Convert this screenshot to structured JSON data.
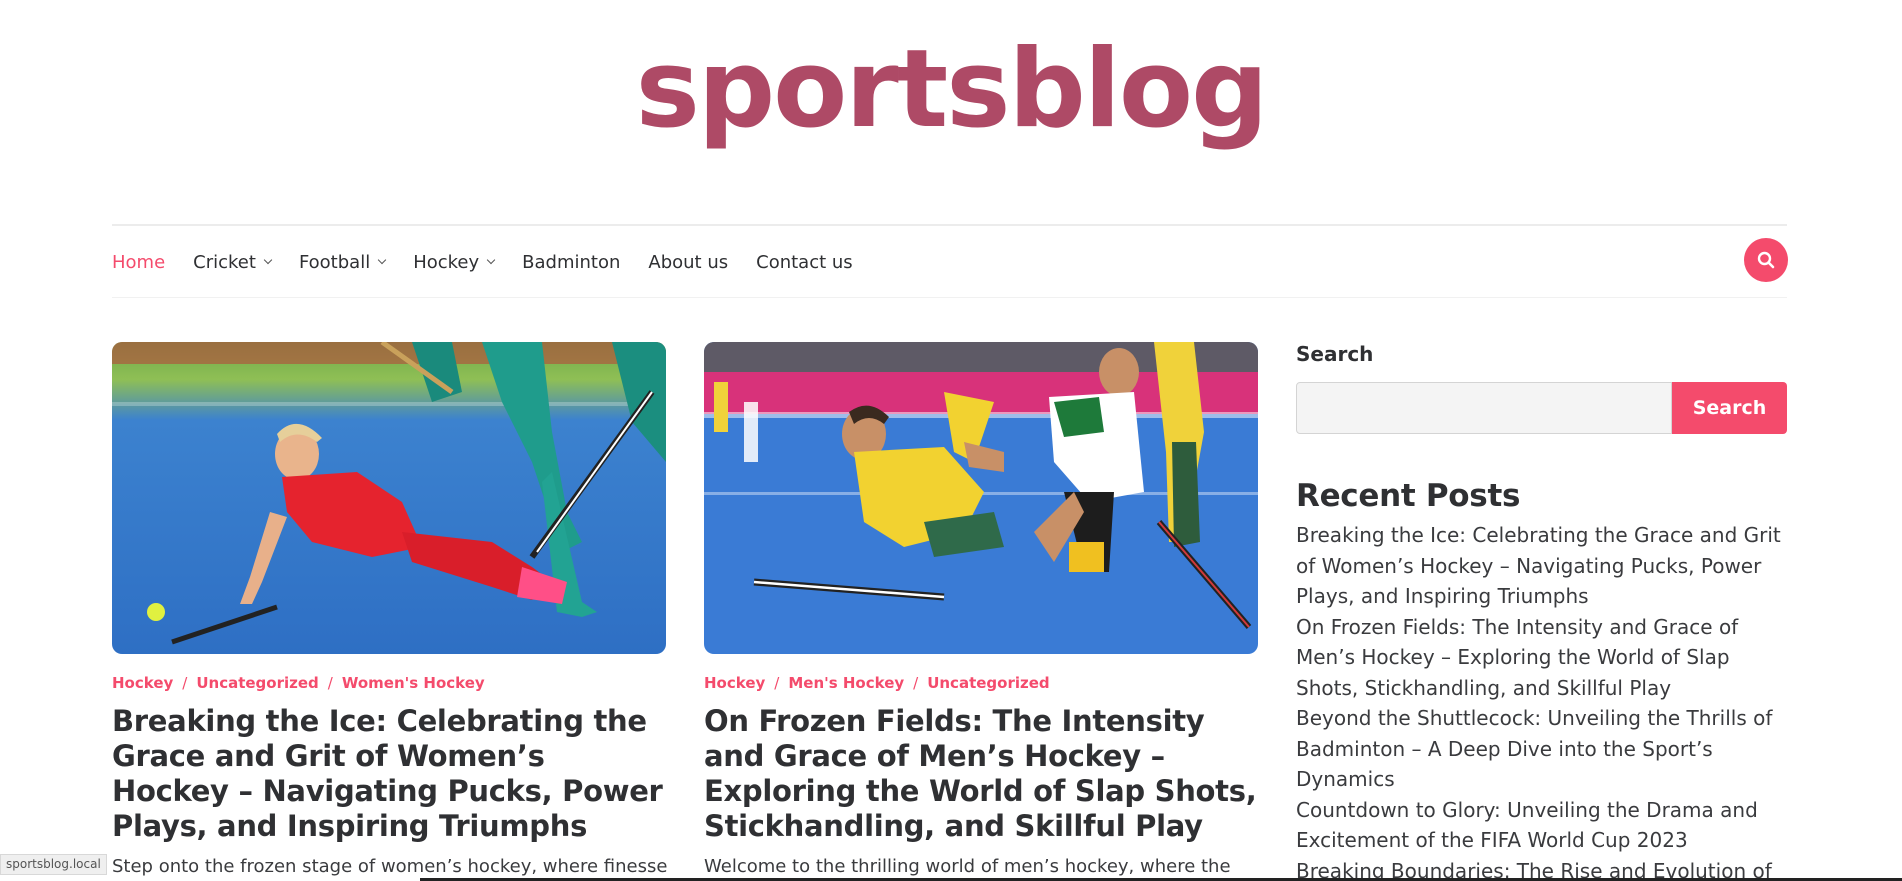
{
  "site": {
    "title": "sportsblog"
  },
  "nav": {
    "items": [
      {
        "label": "Home",
        "active": true,
        "has_submenu": false
      },
      {
        "label": "Cricket",
        "active": false,
        "has_submenu": true
      },
      {
        "label": "Football",
        "active": false,
        "has_submenu": true
      },
      {
        "label": "Hockey",
        "active": false,
        "has_submenu": true
      },
      {
        "label": "Badminton",
        "active": false,
        "has_submenu": false
      },
      {
        "label": "About us",
        "active": false,
        "has_submenu": false
      },
      {
        "label": "Contact us",
        "active": false,
        "has_submenu": false
      }
    ],
    "search_icon": "search-icon"
  },
  "posts": [
    {
      "categories": [
        "Hockey",
        "Uncategorized",
        "Women's Hockey"
      ],
      "title": "Breaking the Ice: Celebrating the Grace and Grit of Women’s Hockey – Navigating Pucks, Power Plays, and Inspiring Triumphs",
      "excerpt": "Step onto the frozen stage of women’s hockey, where finesse",
      "image": "women-field-hockey-player-diving"
    },
    {
      "categories": [
        "Hockey",
        "Men's Hockey",
        "Uncategorized"
      ],
      "title": "On Frozen Fields: The Intensity and Grace of Men’s Hockey – Exploring the World of Slap Shots, Stickhandling, and Skillful Play",
      "excerpt": "Welcome to the thrilling world of men’s hockey, where the",
      "image": "men-field-hockey-players-diving"
    }
  ],
  "sidebar": {
    "search_title": "Search",
    "search_placeholder": "",
    "search_button": "Search",
    "recent_title": "Recent Posts",
    "recent_posts": [
      "Breaking the Ice: Celebrating the Grace and Grit of Women’s Hockey – Navigating Pucks, Power Plays, and Inspiring Triumphs",
      "On Frozen Fields: The Intensity and Grace of Men’s Hockey – Exploring the World of Slap Shots, Stickhandling, and Skillful Play",
      "Beyond the Shuttlecock: Unveiling the Thrills of Badminton – A Deep Dive into the Sport’s Dynamics",
      "Countdown to Glory: Unveiling the Drama and Excitement of the FIFA World Cup 2023",
      "Breaking Boundaries: The Rise and Evolution of"
    ]
  },
  "status_bar": {
    "url": "sportsblog.local"
  },
  "colors": {
    "brand": "#ae4a66",
    "accent": "#f44b6c",
    "text": "#2f3033"
  }
}
